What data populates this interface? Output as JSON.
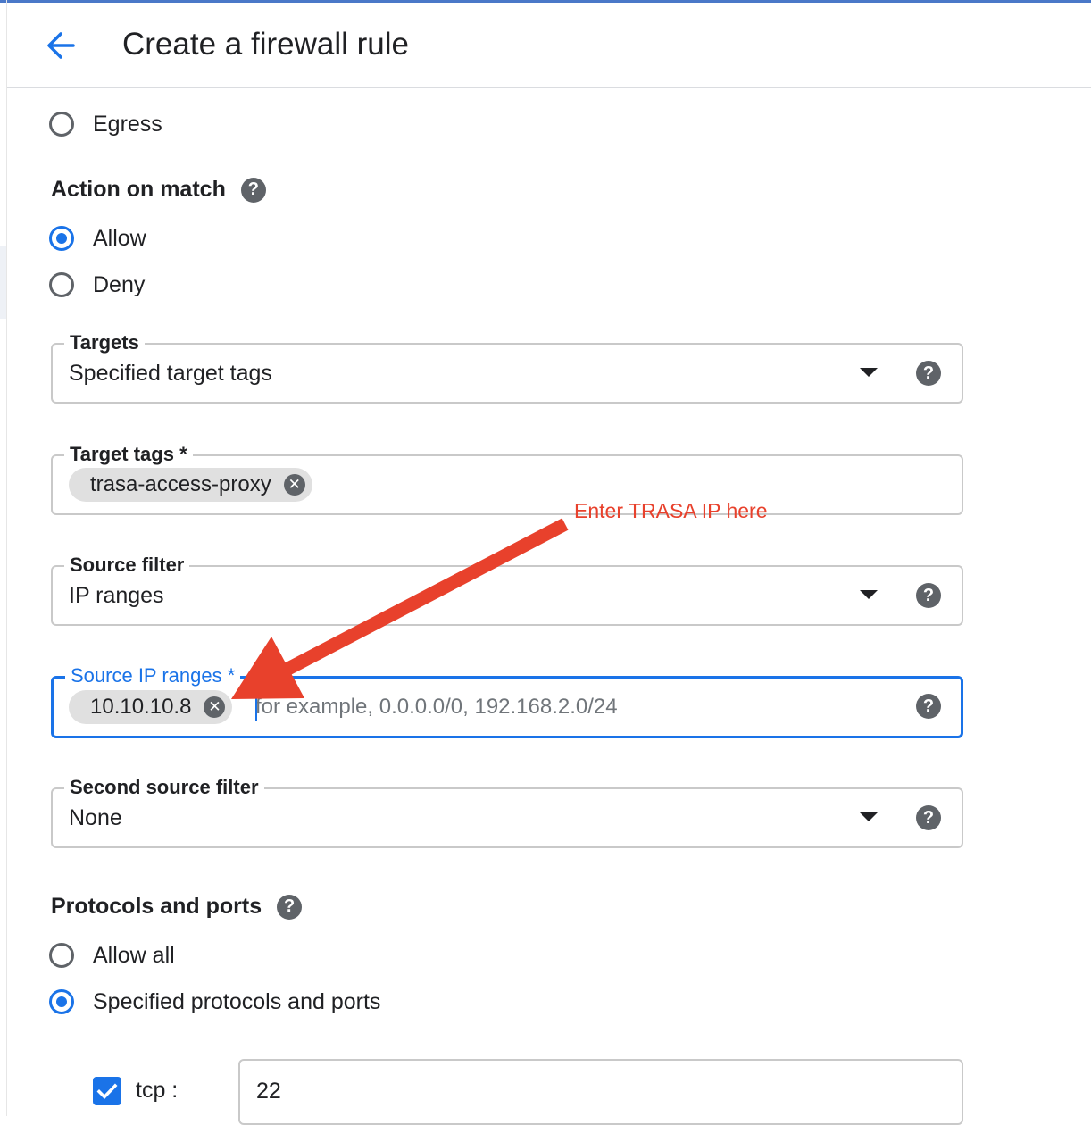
{
  "header": {
    "title": "Create a firewall rule"
  },
  "direction": {
    "options": [
      {
        "label": "Egress",
        "selected": false
      }
    ]
  },
  "action_on_match": {
    "heading": "Action on match",
    "options": [
      {
        "label": "Allow",
        "selected": true
      },
      {
        "label": "Deny",
        "selected": false
      }
    ]
  },
  "targets": {
    "label": "Targets",
    "value": "Specified target tags"
  },
  "target_tags": {
    "label": "Target tags *",
    "chips": [
      "trasa-access-proxy"
    ]
  },
  "source_filter": {
    "label": "Source filter",
    "value": "IP ranges"
  },
  "source_ip_ranges": {
    "label": "Source IP ranges *",
    "chips": [
      "10.10.10.8"
    ],
    "placeholder": "for example, 0.0.0.0/0, 192.168.2.0/24"
  },
  "second_source_filter": {
    "label": "Second source filter",
    "value": "None"
  },
  "protocols_and_ports": {
    "heading": "Protocols and ports",
    "options": [
      {
        "label": "Allow all",
        "selected": false
      },
      {
        "label": "Specified protocols and ports",
        "selected": true
      }
    ],
    "tcp": {
      "label": "tcp :",
      "checked": true,
      "value": "22"
    }
  },
  "annotation": {
    "text": "Enter TRASA IP here",
    "color": "#e8412c"
  },
  "colors": {
    "accent": "#1a73e8",
    "annotation": "#e8412c"
  },
  "icons": {
    "help": "?",
    "chip_remove": "✕"
  }
}
